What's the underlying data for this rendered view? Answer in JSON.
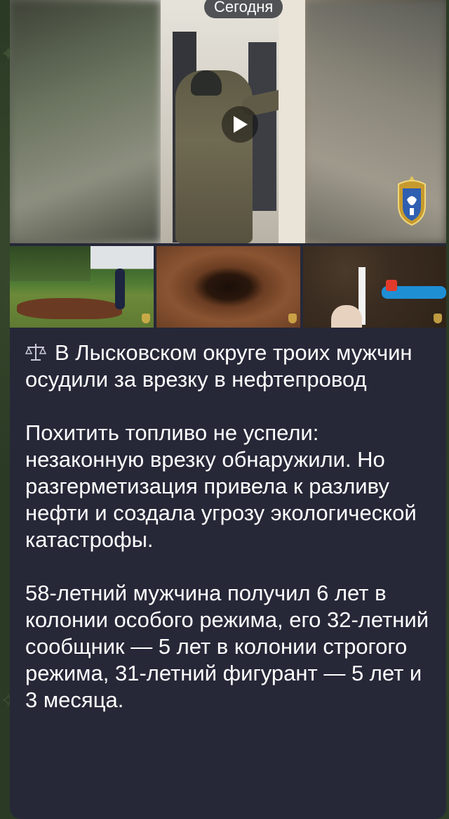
{
  "date_pill": "Сегодня",
  "colors": {
    "bubble": "#262838",
    "text": "#ffffff",
    "pipe": "#1f8fd4"
  },
  "icons": [
    "play-icon",
    "police-emblem-icon",
    "scales-icon"
  ],
  "message": {
    "headline": "В Лысковском округе троих мужчин осудили за врезку в нефтепровод",
    "paragraph1": "Похитить топливо не успели: незаконную врезку обнаружили. Но разгерметизация привела к разливу нефти и создала угрозу экологической катастрофы.",
    "paragraph2": "58-летний мужчина получил 6 лет в колонии особого режима, его 32-летний сообщник — 5 лет в колонии строгого режима, 31-летний фигурант — 5 лет и 3 месяца."
  }
}
